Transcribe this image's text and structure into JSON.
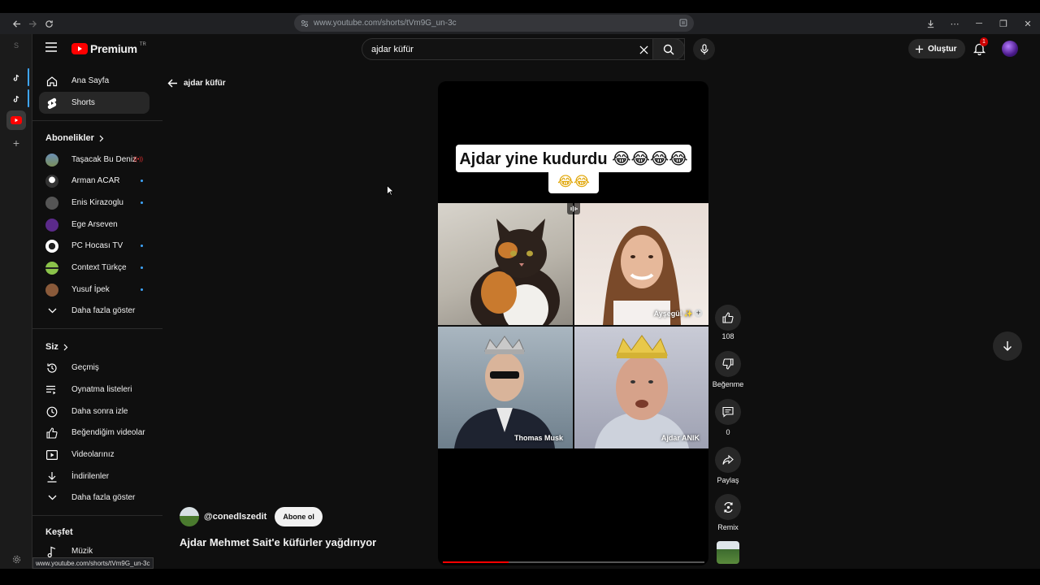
{
  "browser": {
    "url_host": "www.youtube.com",
    "url_path": "/shorts/tVm9G_un-3c",
    "status_url": "www.youtube.com/shorts/tVm9G_un-3c"
  },
  "header": {
    "brand": "Premium",
    "region": "TR",
    "search_value": "ajdar küfür",
    "create_label": "Oluştur",
    "notification_count": "1"
  },
  "sidebar": {
    "main": [
      {
        "label": "Ana Sayfa",
        "icon": "home-icon"
      },
      {
        "label": "Shorts",
        "icon": "shorts-icon"
      }
    ],
    "subs_heading": "Abonelikler",
    "subs": [
      {
        "label": "Taşacak Bu Deniz",
        "avatar_color": "#7a8f5a"
      },
      {
        "label": "Arman ACAR",
        "avatar_color": "#d9d9d9"
      },
      {
        "label": "Enis Kirazoglu",
        "avatar_color": "#555555"
      },
      {
        "label": "Ege Arseven",
        "avatar_color": "#5b2a8a"
      },
      {
        "label": "PC Hocası TV",
        "avatar_color": "#ffffff"
      },
      {
        "label": "Context Türkçe",
        "avatar_color": "#8bc34a"
      },
      {
        "label": "Yusuf İpek",
        "avatar_color": "#8a5a3a"
      }
    ],
    "show_more": "Daha fazla göster",
    "you_heading": "Siz",
    "you": [
      {
        "label": "Geçmiş",
        "icon": "history-icon"
      },
      {
        "label": "Oynatma listeleri",
        "icon": "playlist-icon"
      },
      {
        "label": "Daha sonra izle",
        "icon": "clock-icon"
      },
      {
        "label": "Beğendiğim videolar",
        "icon": "like-icon"
      },
      {
        "label": "Videolarınız",
        "icon": "video-icon"
      },
      {
        "label": "İndirilenler",
        "icon": "download-icon"
      }
    ],
    "show_more_2": "Daha fazla göster",
    "explore_heading": "Keşfet",
    "explore": [
      {
        "label": "Müzik",
        "icon": "music-icon"
      }
    ]
  },
  "main": {
    "back_label": "ajdar küfür",
    "caption_line1": "Ajdar yine kudurdu 😂😂😂😂",
    "caption_line2": "😂😂",
    "tiles": [
      {
        "label": ""
      },
      {
        "label": "Ayşegül ✨"
      },
      {
        "label": "Thomas Musk"
      },
      {
        "label": "Ajdar ANIK"
      }
    ],
    "progress": 0.25,
    "channel": "@conedlszedit",
    "subscribe_label": "Abone ol",
    "title": "Ajdar Mehmet Sait'e küfürler yağdırıyor"
  },
  "actions": {
    "like_count": "108",
    "dislike_label": "Beğenme",
    "comment_count": "0",
    "share_label": "Paylaş",
    "remix_label": "Remix"
  },
  "colors": {
    "accent_red": "#ff0000",
    "background": "#0f0f0f"
  }
}
